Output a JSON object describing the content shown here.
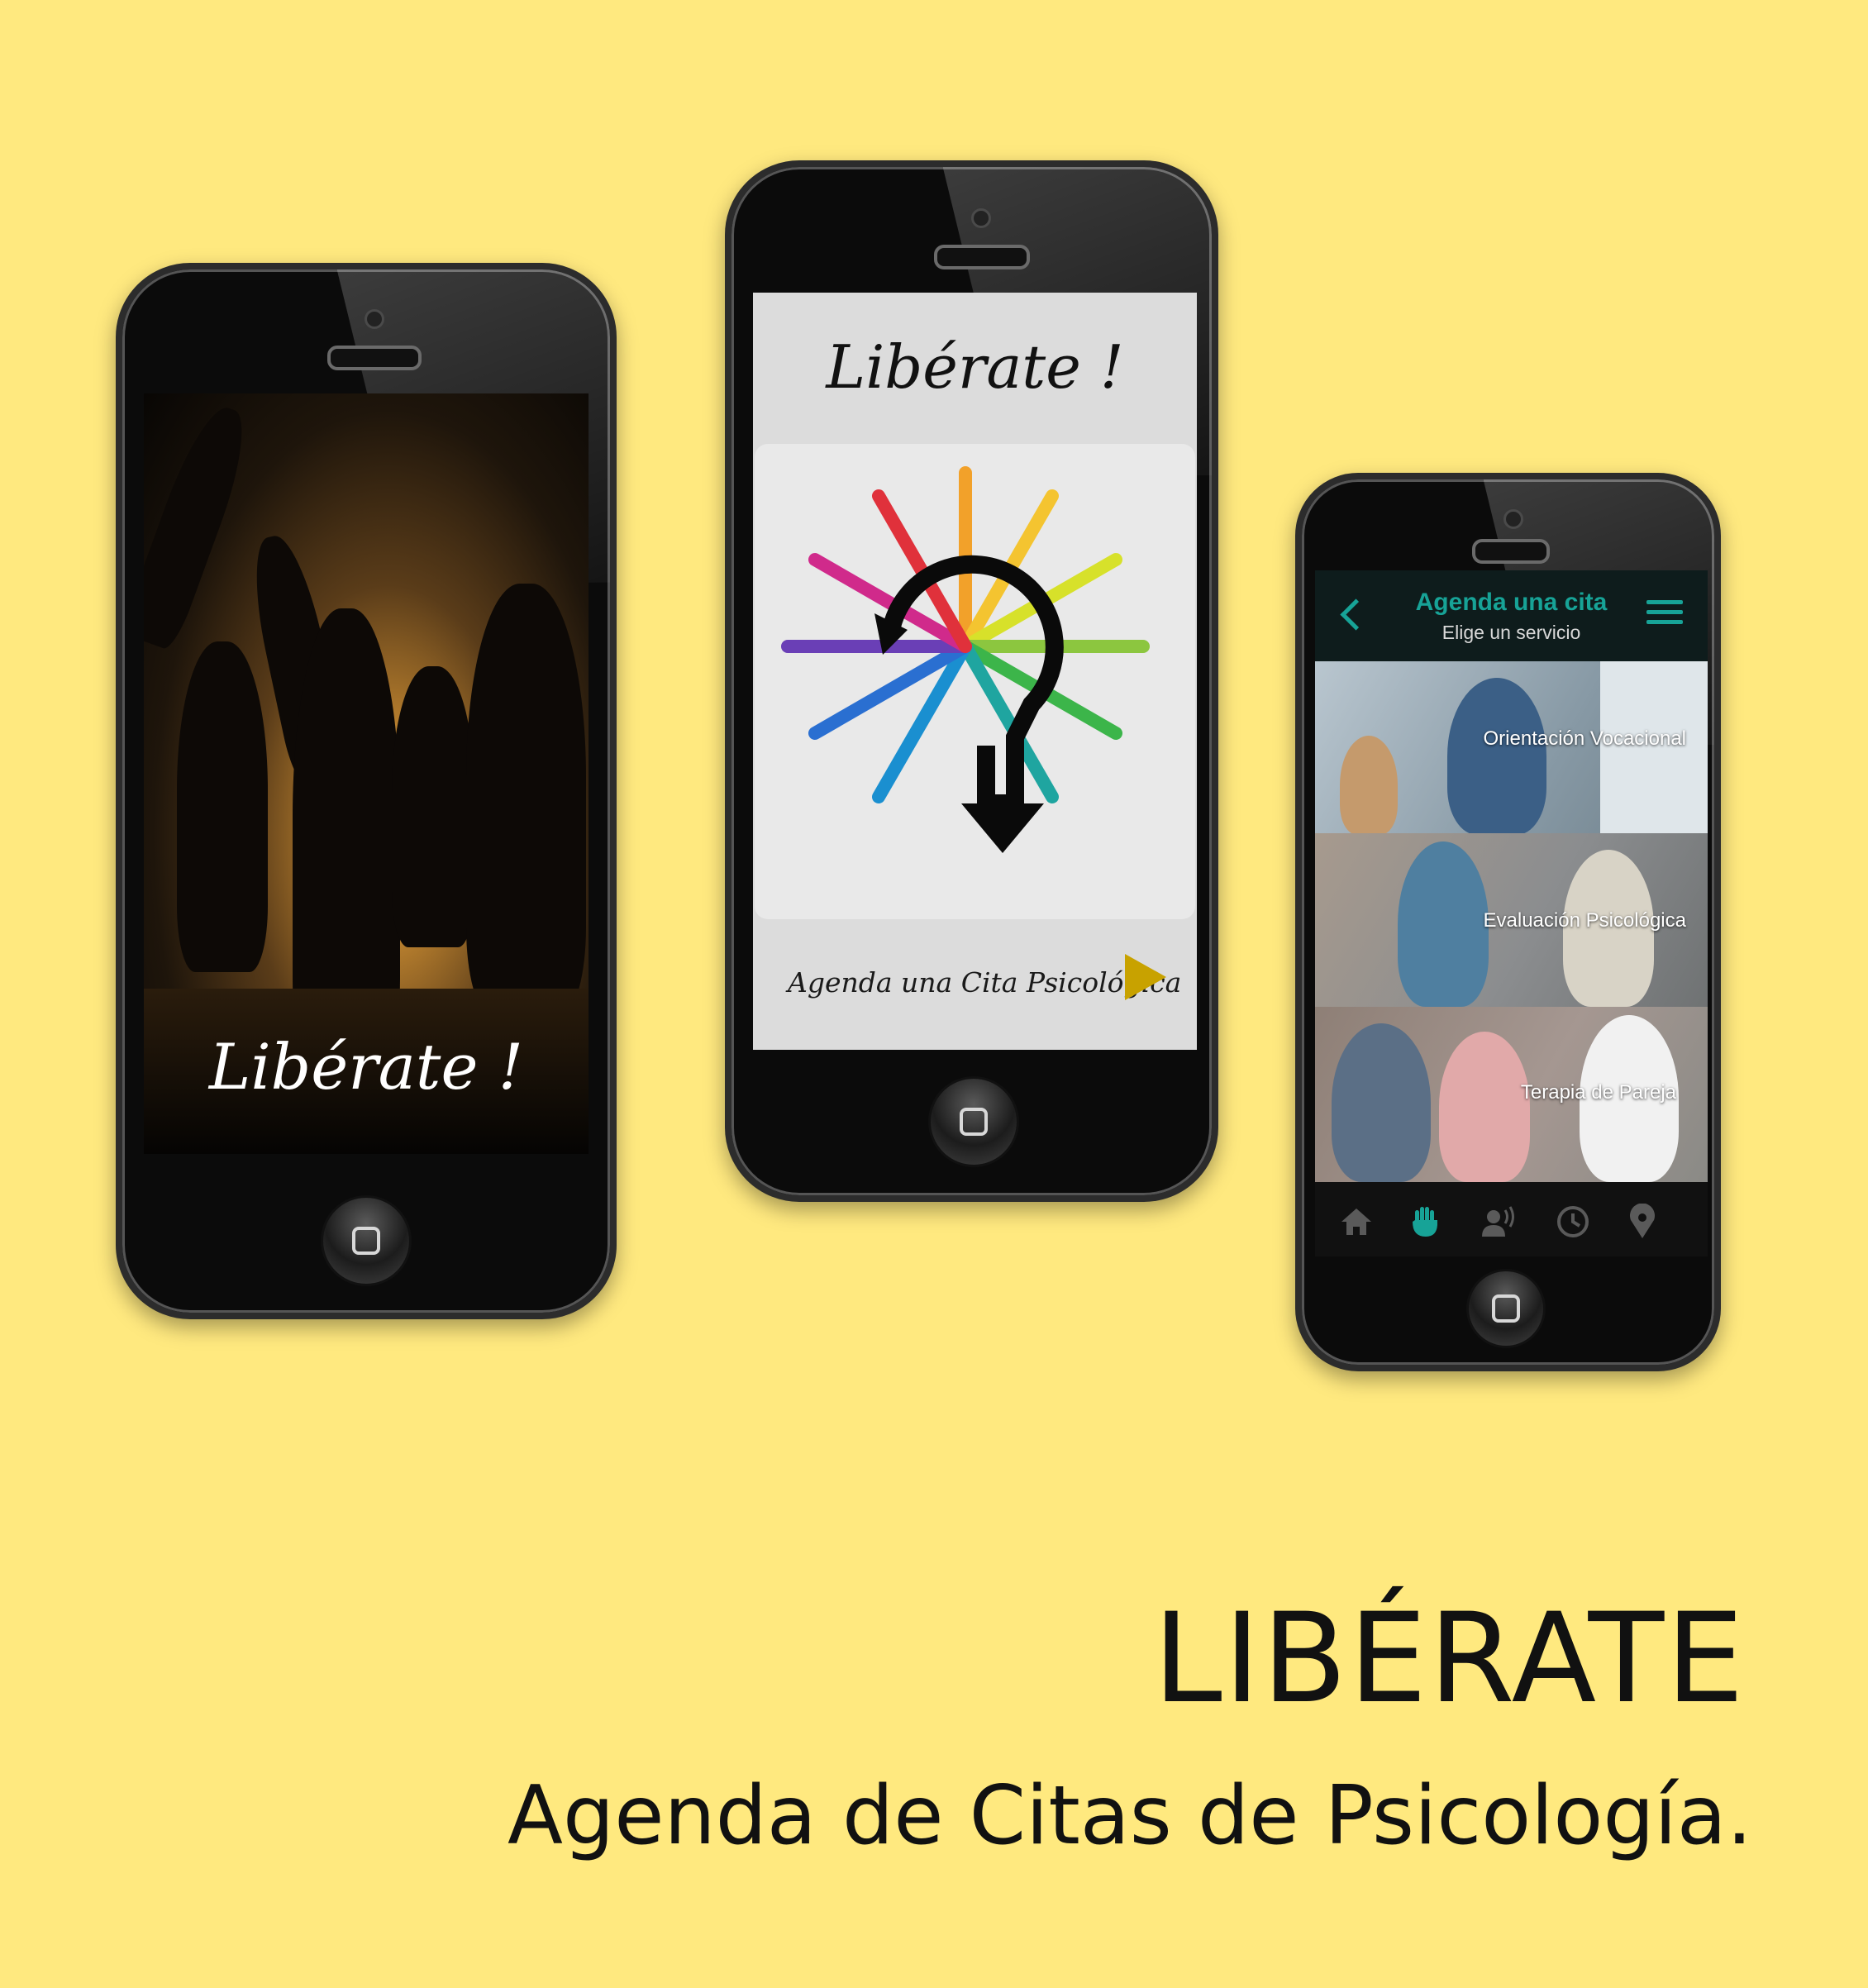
{
  "phone_splash": {
    "title": "Libérate !"
  },
  "phone_home": {
    "title": "Libérate !",
    "cta_label": "Agenda una Cita Psicológica"
  },
  "phone_services": {
    "header": {
      "title": "Agenda una cita",
      "subtitle": "Elige un servicio"
    },
    "services": [
      {
        "label": "Orientación Vocacional"
      },
      {
        "label": "Evaluación Psicológica"
      },
      {
        "label": "Terapia de Pareja"
      }
    ],
    "nav_icons": [
      "home-icon",
      "hand-icon",
      "speaking-person-icon",
      "clock-icon",
      "location-pin-icon"
    ],
    "accent_color": "#17A397"
  },
  "caption": {
    "title": "LIBÉRATE",
    "subtitle": "Agenda de Citas de Psicología."
  },
  "background_color": "#FFE97F"
}
